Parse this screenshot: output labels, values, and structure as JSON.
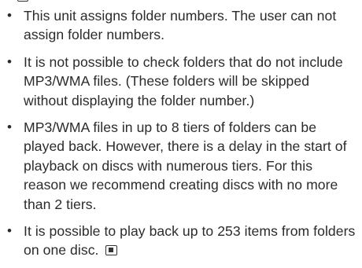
{
  "notes": [
    {
      "text": "This unit assigns folder numbers. The user can not assign folder numbers."
    },
    {
      "text": "It is not possible to check folders that do not include MP3/WMA files. (These folders will be skipped without displaying the folder number.)"
    },
    {
      "text": "MP3/WMA files in up to 8 tiers of folders can be played back. However, there is a delay in the start of playback on discs with numerous tiers. For this reason we recommend creating discs with no more than 2 tiers."
    },
    {
      "text": "It is possible to play back up to 253 items from folders on one disc."
    }
  ],
  "bullet_glyph": "•",
  "icons": {
    "top_mark": "note-start-icon",
    "end_mark": "section-end-icon"
  },
  "colors": {
    "text": "#2b2b2b",
    "background": "#ffffff"
  }
}
